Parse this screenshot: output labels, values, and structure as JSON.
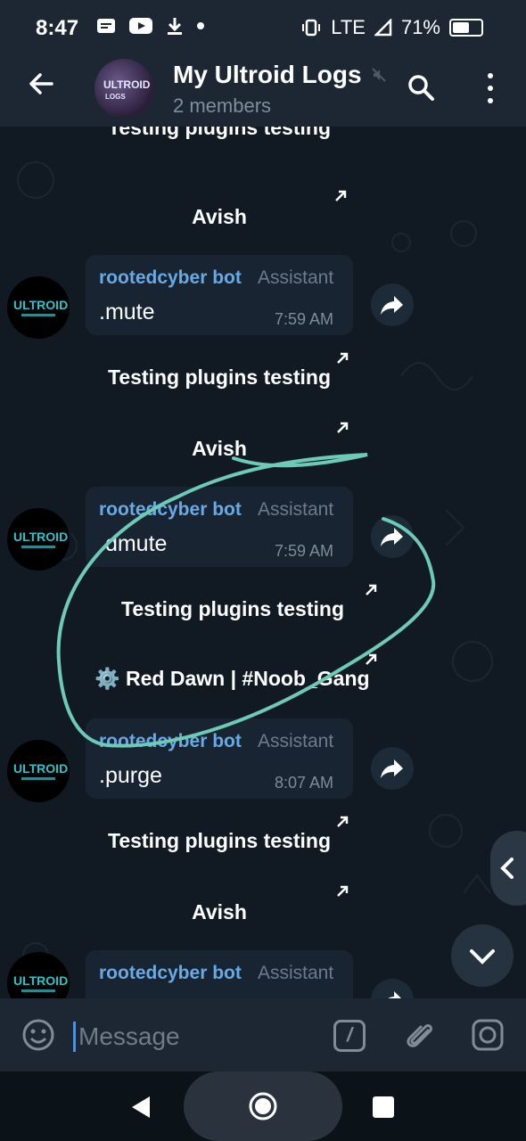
{
  "status_bar": {
    "time": "8:47",
    "left_icons": [
      "message-icon",
      "youtube-icon",
      "download-icon",
      "dot-icon"
    ],
    "network": "LTE",
    "battery_percent": "71%",
    "battery_level": 0.71
  },
  "header": {
    "title": "My Ultroid Logs",
    "subtitle": "2 members",
    "avatar_text_line1": "ULTROID",
    "avatar_text_line2": "LOGS"
  },
  "messages": {
    "partial_top": "Testing plugins testing",
    "avish_1": "Avish",
    "bot_1": {
      "sender": "rootedcyber bot",
      "role": "Assistant",
      "text": ".mute",
      "time": "7:59 AM"
    },
    "plugins_1": "Testing plugins testing",
    "avish_2": "Avish",
    "bot_2": {
      "sender": "rootedcyber bot",
      "role": "Assistant",
      "text": ".dmute",
      "time": "7:59 AM"
    },
    "plugins_2": "Testing plugins testing",
    "red_dawn": "⚙️ Red Dawn  | #Noob_Gang",
    "bot_3": {
      "sender": "rootedcyber bot",
      "role": "Assistant",
      "text": ".purge",
      "time": "8:07 AM"
    },
    "plugins_3": "Testing plugins testing",
    "avish_3": "Avish",
    "bot_4": {
      "sender": "rootedcyber bot",
      "role": "Assistant"
    },
    "bot_avatar_text": "ULTROID"
  },
  "input": {
    "placeholder": "Message"
  },
  "colors": {
    "header_bg": "#1d2733",
    "chat_bg": "#111a23",
    "bubble_bg": "#182432",
    "sender_blue": "#69a9e4",
    "annotation_teal": "#6ccab6"
  }
}
